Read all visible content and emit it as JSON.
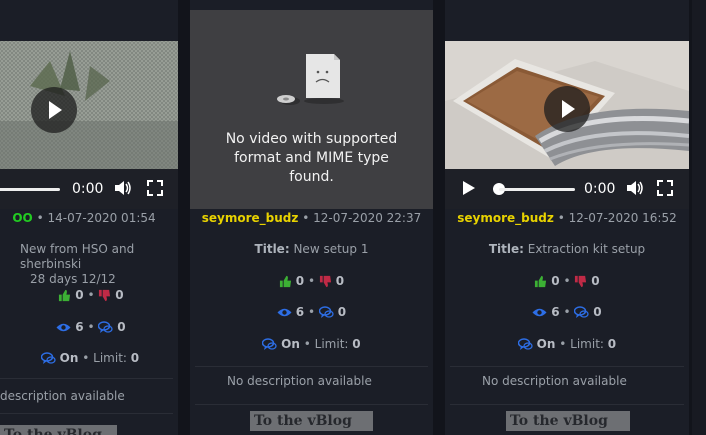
{
  "cards": [
    {
      "time": "0:00",
      "author": "OO",
      "date": "14-07-2020 01:54",
      "title_lines": [
        "New from HSO and sherbinski",
        "28 days 12/12"
      ],
      "likes": "0",
      "dislikes": "0",
      "views": "6",
      "comments": "0",
      "comments_status": "On",
      "limit_label": "Limit:",
      "limit_value": "0",
      "description": "description available",
      "button_label": "To the vBlog"
    },
    {
      "error_message": "No video with supported format and MIME type found.",
      "author": "seymore_budz",
      "date": "12-07-2020 22:37",
      "title_label": "Title:",
      "title": "New setup 1",
      "likes": "0",
      "dislikes": "0",
      "views": "6",
      "comments": "0",
      "comments_status": "On",
      "limit_label": "Limit:",
      "limit_value": "0",
      "description": "No description available",
      "button_label": "To the vBlog"
    },
    {
      "time": "0:00",
      "author": "seymore_budz",
      "date": "12-07-2020 16:52",
      "title_label": "Title:",
      "title": "Extraction kit setup",
      "likes": "0",
      "dislikes": "0",
      "views": "6",
      "comments": "0",
      "comments_status": "On",
      "limit_label": "Limit:",
      "limit_value": "0",
      "description": "No description available",
      "button_label": "To the vBlog"
    }
  ],
  "separator": "•",
  "colors": {
    "author": "#e8d200",
    "author_green": "#22cc22",
    "like": "#3cb034",
    "dislike": "#c02a46",
    "eye": "#2d6ee6",
    "comment": "#2d6ee6",
    "background": "#1b1e27",
    "button_bg": "#6d6f73"
  },
  "icons": {
    "like": "thumbs-up-icon",
    "dislike": "thumbs-down-icon",
    "views": "eye-icon",
    "comments": "comment-bubbles-icon",
    "play": "play-icon",
    "volume": "volume-icon",
    "fullscreen": "fullscreen-icon",
    "monitor": "monitor-icon",
    "sad_file": "sad-file-icon"
  }
}
